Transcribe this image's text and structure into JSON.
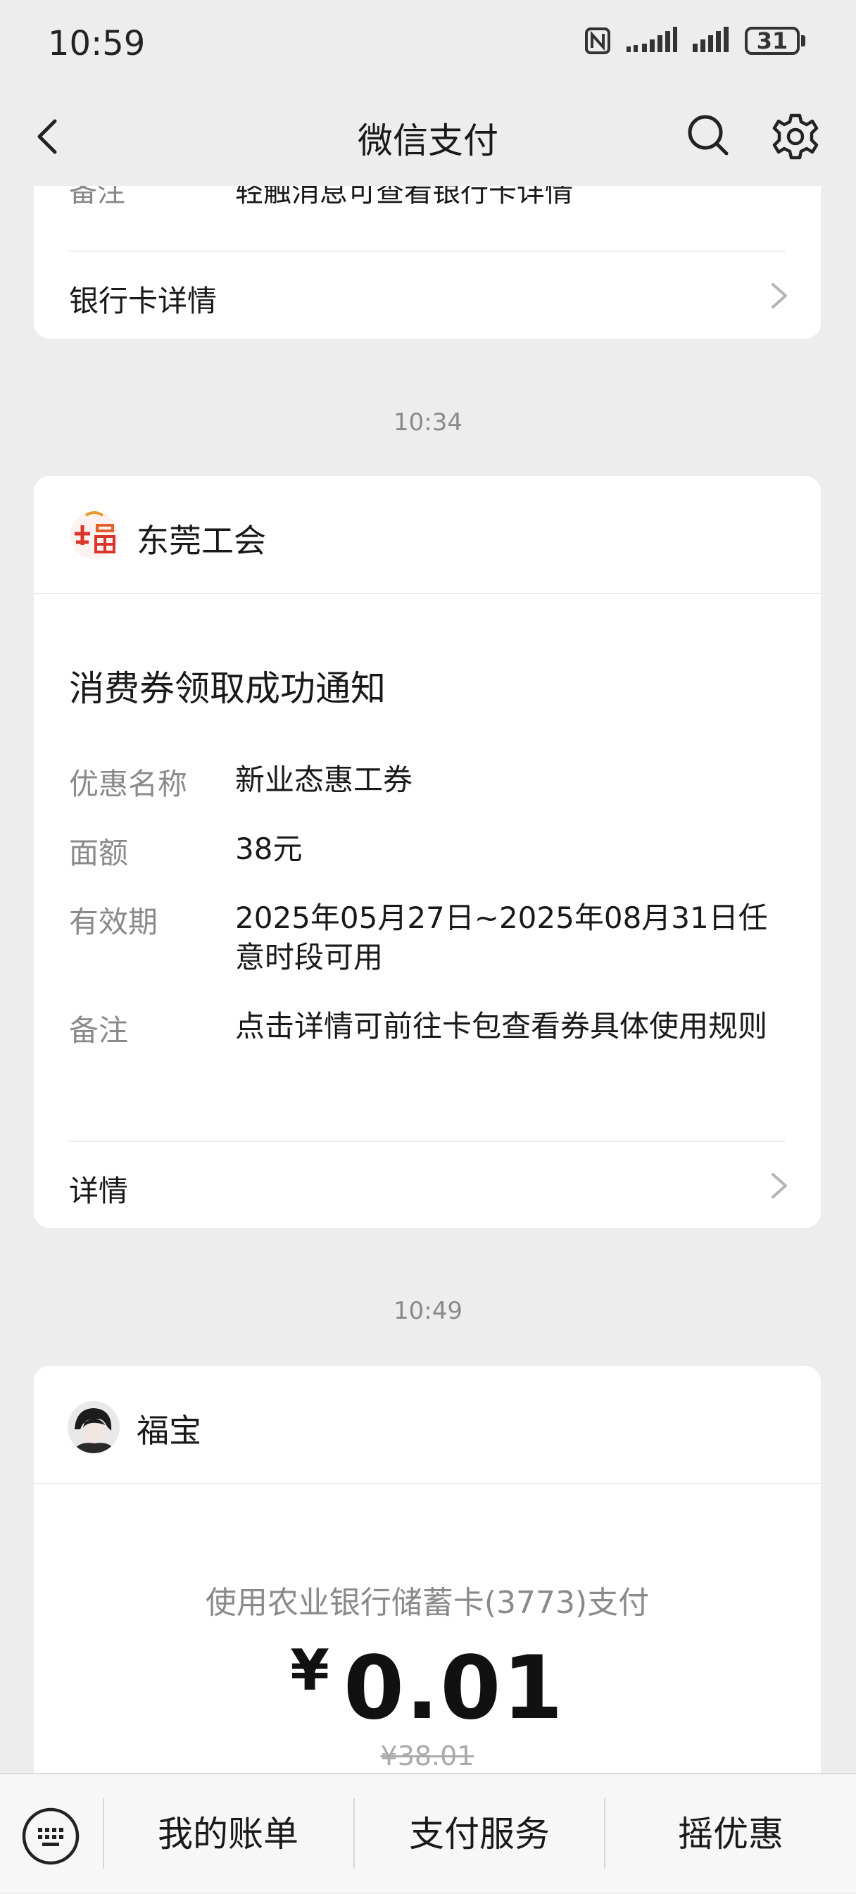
{
  "status_bar": {
    "time": "10:59",
    "battery": "31"
  },
  "header": {
    "title": "微信支付"
  },
  "card_bank": {
    "cut_label": "备注",
    "cut_value": "轻触消息可查看银行卡详情",
    "detail_link": "银行卡详情"
  },
  "timestamps": [
    "10:34",
    "10:49"
  ],
  "card_union": {
    "sender": "东莞工会",
    "title": "消费券领取成功通知",
    "rows": [
      {
        "key": "优惠名称",
        "value": "新业态惠工券"
      },
      {
        "key": "面额",
        "value": "38元"
      },
      {
        "key": "有效期",
        "value": "2025年05月27日~2025年08月31日任意时段可用"
      },
      {
        "key": "备注",
        "value": "点击详情可前往卡包查看券具体使用规则"
      }
    ],
    "detail_link": "详情"
  },
  "card_payment": {
    "sender": "福宝",
    "method": "使用农业银行储蓄卡(3773)支付",
    "currency": "¥",
    "amount": "0.01",
    "original": "¥38.01"
  },
  "bottom_bar": {
    "tabs": [
      "我的账单",
      "支付服务",
      "摇优惠"
    ]
  },
  "icons": {
    "back": "back-arrow-icon",
    "search": "search-icon",
    "settings": "gear-icon",
    "keyboard": "keyboard-icon",
    "chevron": "chevron-right-icon"
  }
}
